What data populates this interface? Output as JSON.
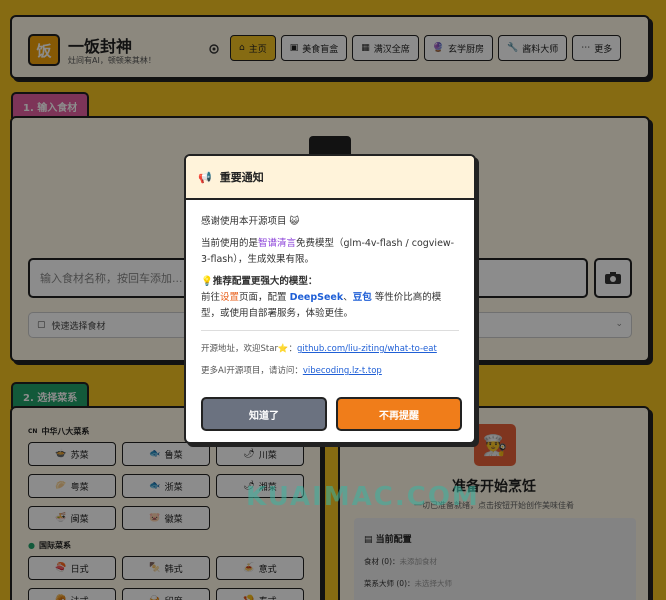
{
  "app": {
    "logo_char": "饭",
    "title": "一饭封神",
    "subtitle": "灶间有AI，顿顿来其林！"
  },
  "nav": [
    {
      "label": "主页",
      "icon": "home-icon",
      "active": true
    },
    {
      "label": "美食盲盒",
      "icon": "box-icon",
      "active": false
    },
    {
      "label": "满汉全席",
      "icon": "feast-icon",
      "active": false
    },
    {
      "label": "玄学厨房",
      "icon": "crystal-icon",
      "active": false
    },
    {
      "label": "酱料大师",
      "icon": "wrench-icon",
      "active": false
    },
    {
      "label": "更多",
      "icon": "more-icon",
      "active": false
    }
  ],
  "section1": {
    "tab": "1. 输入食材",
    "input_placeholder": "输入食材名称，按回车添加...",
    "quick_select": "快速选择食材"
  },
  "section2": {
    "tab": "2. 选择菜系",
    "group1_label": "中华八大菜系",
    "group1_prefix": "CN",
    "group1": [
      {
        "label": "苏菜",
        "icon": "🍲"
      },
      {
        "label": "鲁菜",
        "icon": "🐟"
      },
      {
        "label": "川菜",
        "icon": "🌶"
      },
      {
        "label": "粤菜",
        "icon": "🥟"
      },
      {
        "label": "浙菜",
        "icon": "🐟"
      },
      {
        "label": "湘菜",
        "icon": "🌶"
      },
      {
        "label": "闽菜",
        "icon": "🍜"
      },
      {
        "label": "徽菜",
        "icon": "🐷"
      }
    ],
    "group2_label": "国际菜系",
    "group2": [
      {
        "label": "日式",
        "icon": "🍣"
      },
      {
        "label": "韩式",
        "icon": "🍢"
      },
      {
        "label": "意式",
        "icon": "🍝"
      },
      {
        "label": "法式",
        "icon": "🥐"
      },
      {
        "label": "印度",
        "icon": "🍛"
      },
      {
        "label": "泰式",
        "icon": "🍤"
      }
    ]
  },
  "panel": {
    "title": "准备开始烹饪",
    "subtitle": "一切已准备就绪，点击按钮开始创作美味佳肴",
    "config_title": "当前配置",
    "ingredients_label": "食材 (0)：",
    "ingredients_value": "未添加食材",
    "chef_label": "菜系大师 (0)：",
    "chef_value": "未选择大师"
  },
  "modal": {
    "title": "重要通知",
    "thanks": "感谢使用本开源项目",
    "line2_a": "当前使用的是",
    "line2_hl": "智谱清言",
    "line2_b": "免费模型（glm-4v-flash / cogview-3-flash），生成效果有限。",
    "recommend_title": "推荐配置更强大的模型：",
    "rec_a": "前往",
    "rec_settings": "设置",
    "rec_b": "页面，配置",
    "rec_ds": "DeepSeek",
    "rec_sep": "、",
    "rec_db": "豆包",
    "rec_c": "等性价比高的模型，或使用自部署服务，体验更佳。",
    "opensource_label": "开源地址，欢迎Star⭐：",
    "opensource_link": "github.com/liu-ziting/what-to-eat",
    "more_label": "更多AI开源项目，请访问：",
    "more_link": "vibecoding.lz-t.top",
    "btn_ok": "知道了",
    "btn_never": "不再提醒"
  },
  "watermark": "KUAIMAC.COM",
  "colors": {
    "background": "#f5c321",
    "accent": "#f07d1a",
    "tab1": "#e35fa0",
    "tab2": "#21a36a"
  }
}
